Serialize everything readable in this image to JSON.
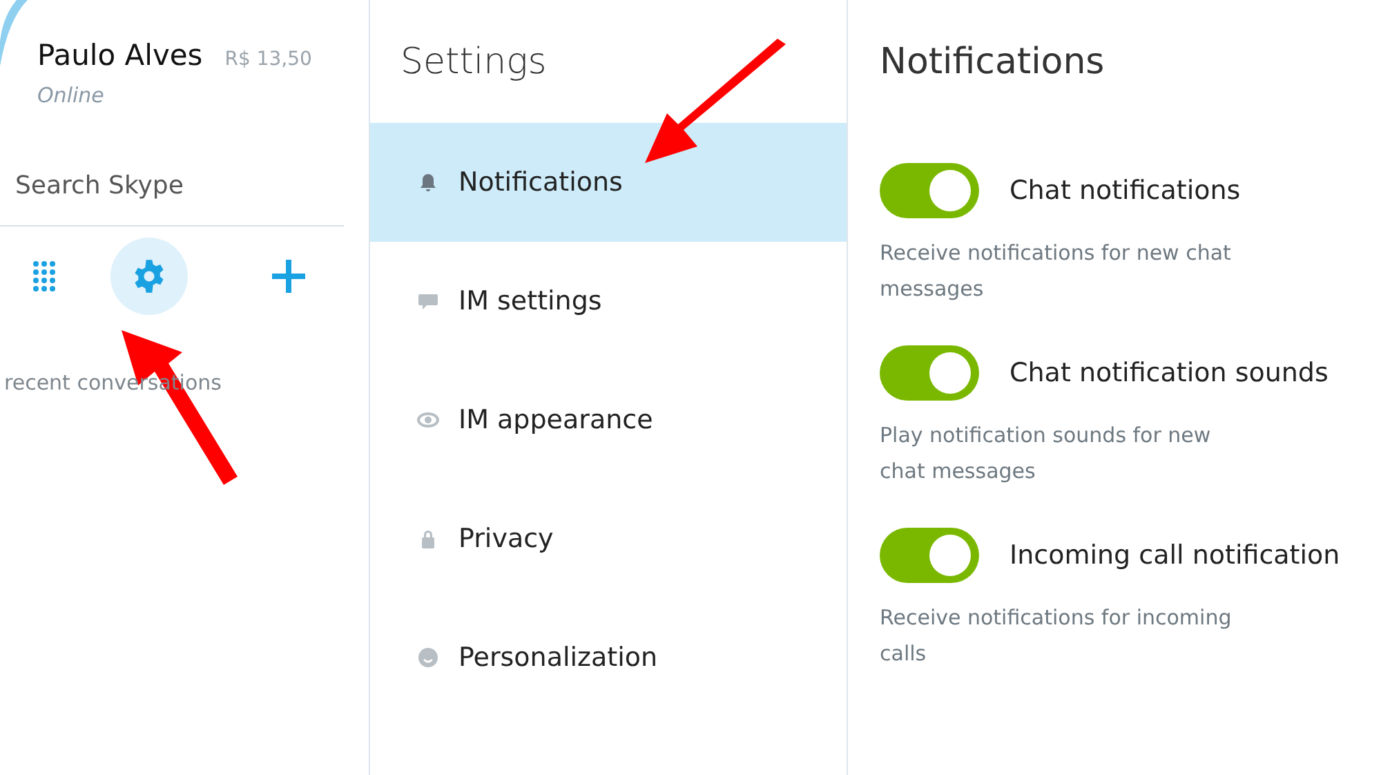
{
  "profile": {
    "name": "Paulo Alves",
    "credit": "R$ 13,50",
    "status": "Online"
  },
  "search": {
    "placeholder": "Search Skype"
  },
  "toolbar": [
    {
      "kind": "dialpad",
      "selected": false
    },
    {
      "kind": "settings",
      "selected": true
    },
    {
      "kind": "add",
      "selected": false
    }
  ],
  "conversations_hint": "recent conversations",
  "settings": {
    "title": "Settings",
    "items": [
      {
        "label": "Notifications",
        "kind": "bell",
        "selected": true
      },
      {
        "label": "IM settings",
        "kind": "chat",
        "selected": false
      },
      {
        "label": "IM appearance",
        "kind": "eye",
        "selected": false
      },
      {
        "label": "Privacy",
        "kind": "lock",
        "selected": false
      },
      {
        "label": "Personalization",
        "kind": "smile",
        "selected": false
      }
    ]
  },
  "notifications": {
    "title": "Notifications",
    "options": [
      {
        "label": "Chat notifications",
        "on": true,
        "description": "Receive notifications for new chat messages"
      },
      {
        "label": "Chat notification sounds",
        "on": true,
        "description": "Play notification sounds for new chat messages"
      },
      {
        "label": "Incoming call notification",
        "on": true,
        "description": "Receive notifications for incoming calls"
      }
    ]
  }
}
